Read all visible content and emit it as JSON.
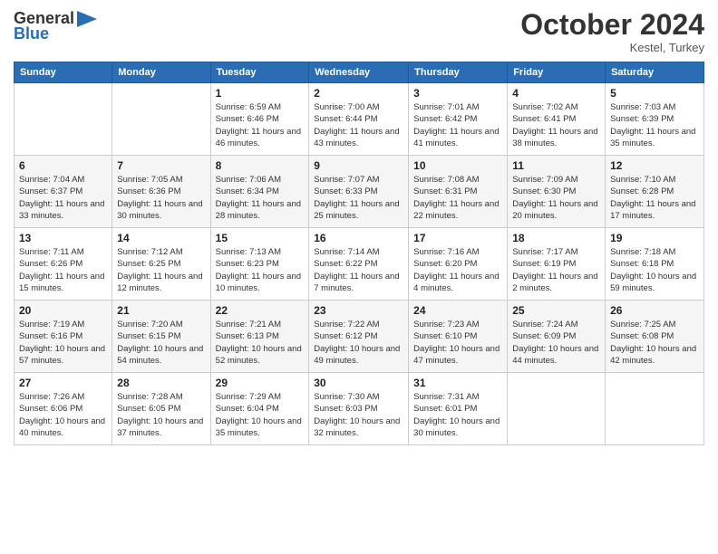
{
  "header": {
    "logo_line1": "General",
    "logo_line2": "Blue",
    "month_title": "October 2024",
    "location": "Kestel, Turkey"
  },
  "weekdays": [
    "Sunday",
    "Monday",
    "Tuesday",
    "Wednesday",
    "Thursday",
    "Friday",
    "Saturday"
  ],
  "weeks": [
    [
      {
        "day": "",
        "sunrise": "",
        "sunset": "",
        "daylight": ""
      },
      {
        "day": "",
        "sunrise": "",
        "sunset": "",
        "daylight": ""
      },
      {
        "day": "1",
        "sunrise": "Sunrise: 6:59 AM",
        "sunset": "Sunset: 6:46 PM",
        "daylight": "Daylight: 11 hours and 46 minutes."
      },
      {
        "day": "2",
        "sunrise": "Sunrise: 7:00 AM",
        "sunset": "Sunset: 6:44 PM",
        "daylight": "Daylight: 11 hours and 43 minutes."
      },
      {
        "day": "3",
        "sunrise": "Sunrise: 7:01 AM",
        "sunset": "Sunset: 6:42 PM",
        "daylight": "Daylight: 11 hours and 41 minutes."
      },
      {
        "day": "4",
        "sunrise": "Sunrise: 7:02 AM",
        "sunset": "Sunset: 6:41 PM",
        "daylight": "Daylight: 11 hours and 38 minutes."
      },
      {
        "day": "5",
        "sunrise": "Sunrise: 7:03 AM",
        "sunset": "Sunset: 6:39 PM",
        "daylight": "Daylight: 11 hours and 35 minutes."
      }
    ],
    [
      {
        "day": "6",
        "sunrise": "Sunrise: 7:04 AM",
        "sunset": "Sunset: 6:37 PM",
        "daylight": "Daylight: 11 hours and 33 minutes."
      },
      {
        "day": "7",
        "sunrise": "Sunrise: 7:05 AM",
        "sunset": "Sunset: 6:36 PM",
        "daylight": "Daylight: 11 hours and 30 minutes."
      },
      {
        "day": "8",
        "sunrise": "Sunrise: 7:06 AM",
        "sunset": "Sunset: 6:34 PM",
        "daylight": "Daylight: 11 hours and 28 minutes."
      },
      {
        "day": "9",
        "sunrise": "Sunrise: 7:07 AM",
        "sunset": "Sunset: 6:33 PM",
        "daylight": "Daylight: 11 hours and 25 minutes."
      },
      {
        "day": "10",
        "sunrise": "Sunrise: 7:08 AM",
        "sunset": "Sunset: 6:31 PM",
        "daylight": "Daylight: 11 hours and 22 minutes."
      },
      {
        "day": "11",
        "sunrise": "Sunrise: 7:09 AM",
        "sunset": "Sunset: 6:30 PM",
        "daylight": "Daylight: 11 hours and 20 minutes."
      },
      {
        "day": "12",
        "sunrise": "Sunrise: 7:10 AM",
        "sunset": "Sunset: 6:28 PM",
        "daylight": "Daylight: 11 hours and 17 minutes."
      }
    ],
    [
      {
        "day": "13",
        "sunrise": "Sunrise: 7:11 AM",
        "sunset": "Sunset: 6:26 PM",
        "daylight": "Daylight: 11 hours and 15 minutes."
      },
      {
        "day": "14",
        "sunrise": "Sunrise: 7:12 AM",
        "sunset": "Sunset: 6:25 PM",
        "daylight": "Daylight: 11 hours and 12 minutes."
      },
      {
        "day": "15",
        "sunrise": "Sunrise: 7:13 AM",
        "sunset": "Sunset: 6:23 PM",
        "daylight": "Daylight: 11 hours and 10 minutes."
      },
      {
        "day": "16",
        "sunrise": "Sunrise: 7:14 AM",
        "sunset": "Sunset: 6:22 PM",
        "daylight": "Daylight: 11 hours and 7 minutes."
      },
      {
        "day": "17",
        "sunrise": "Sunrise: 7:16 AM",
        "sunset": "Sunset: 6:20 PM",
        "daylight": "Daylight: 11 hours and 4 minutes."
      },
      {
        "day": "18",
        "sunrise": "Sunrise: 7:17 AM",
        "sunset": "Sunset: 6:19 PM",
        "daylight": "Daylight: 11 hours and 2 minutes."
      },
      {
        "day": "19",
        "sunrise": "Sunrise: 7:18 AM",
        "sunset": "Sunset: 6:18 PM",
        "daylight": "Daylight: 10 hours and 59 minutes."
      }
    ],
    [
      {
        "day": "20",
        "sunrise": "Sunrise: 7:19 AM",
        "sunset": "Sunset: 6:16 PM",
        "daylight": "Daylight: 10 hours and 57 minutes."
      },
      {
        "day": "21",
        "sunrise": "Sunrise: 7:20 AM",
        "sunset": "Sunset: 6:15 PM",
        "daylight": "Daylight: 10 hours and 54 minutes."
      },
      {
        "day": "22",
        "sunrise": "Sunrise: 7:21 AM",
        "sunset": "Sunset: 6:13 PM",
        "daylight": "Daylight: 10 hours and 52 minutes."
      },
      {
        "day": "23",
        "sunrise": "Sunrise: 7:22 AM",
        "sunset": "Sunset: 6:12 PM",
        "daylight": "Daylight: 10 hours and 49 minutes."
      },
      {
        "day": "24",
        "sunrise": "Sunrise: 7:23 AM",
        "sunset": "Sunset: 6:10 PM",
        "daylight": "Daylight: 10 hours and 47 minutes."
      },
      {
        "day": "25",
        "sunrise": "Sunrise: 7:24 AM",
        "sunset": "Sunset: 6:09 PM",
        "daylight": "Daylight: 10 hours and 44 minutes."
      },
      {
        "day": "26",
        "sunrise": "Sunrise: 7:25 AM",
        "sunset": "Sunset: 6:08 PM",
        "daylight": "Daylight: 10 hours and 42 minutes."
      }
    ],
    [
      {
        "day": "27",
        "sunrise": "Sunrise: 7:26 AM",
        "sunset": "Sunset: 6:06 PM",
        "daylight": "Daylight: 10 hours and 40 minutes."
      },
      {
        "day": "28",
        "sunrise": "Sunrise: 7:28 AM",
        "sunset": "Sunset: 6:05 PM",
        "daylight": "Daylight: 10 hours and 37 minutes."
      },
      {
        "day": "29",
        "sunrise": "Sunrise: 7:29 AM",
        "sunset": "Sunset: 6:04 PM",
        "daylight": "Daylight: 10 hours and 35 minutes."
      },
      {
        "day": "30",
        "sunrise": "Sunrise: 7:30 AM",
        "sunset": "Sunset: 6:03 PM",
        "daylight": "Daylight: 10 hours and 32 minutes."
      },
      {
        "day": "31",
        "sunrise": "Sunrise: 7:31 AM",
        "sunset": "Sunset: 6:01 PM",
        "daylight": "Daylight: 10 hours and 30 minutes."
      },
      {
        "day": "",
        "sunrise": "",
        "sunset": "",
        "daylight": ""
      },
      {
        "day": "",
        "sunrise": "",
        "sunset": "",
        "daylight": ""
      }
    ]
  ]
}
